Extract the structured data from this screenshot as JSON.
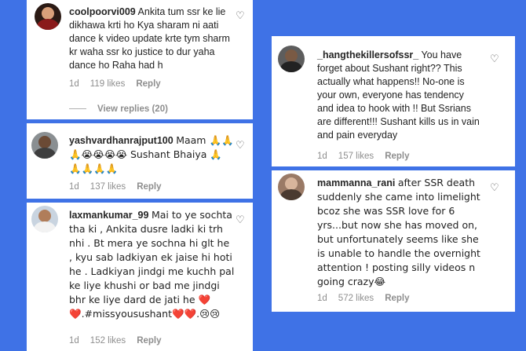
{
  "comments": [
    {
      "username": "coolpoorvi009",
      "text": "Ankita tum ssr ke lie dikhawa krti ho Kya sharam ni aati dance k video update krte tym sharm kr waha ssr ko justice to dur yaha dance ho Raha had h",
      "time": "1d",
      "likes": "119 likes",
      "reply": "Reply",
      "view_replies": "View replies (20)"
    },
    {
      "username": "yashvardhanrajput100",
      "text": "Maam 🙏🙏🙏😭😭😭😭 Sushant Bhaiya 🙏🙏🙏🙏🙏",
      "time": "1d",
      "likes": "137 likes",
      "reply": "Reply"
    },
    {
      "username": "laxmankumar_99",
      "text": "Mai to ye sochta tha ki , Ankita dusre ladki ki trh nhi . Bt mera ye sochna hi glt he , kyu sab ladkiyan ek jaise hi hoti he . Ladkiyan jindgi me kuchh pal ke liye khushi or bad me jindgi bhr ke liye dard de jati he ❤️❤️.#missyousushant❤️❤️.😢😢",
      "time": "1d",
      "likes": "152 likes",
      "reply": "Reply"
    },
    {
      "username": "_hangthekillersofssr_",
      "text": "You have forget about Sushant right?? This actually what happens!! No-one is your own, everyone has tendency and idea to hook with !! But Ssrians are different!!! Sushant kills us in vain and pain everyday",
      "time": "1d",
      "likes": "157 likes",
      "reply": "Reply"
    },
    {
      "username": "mammanna_rani",
      "text": "after SSR death suddenly she came into limelight bcoz she was SSR love for 6 yrs...but now she has moved on, but unfortunately seems like she is unable to handle the overnight attention ! posting silly videos n going crazy😂",
      "time": "1d",
      "likes": "572 likes",
      "reply": "Reply"
    }
  ],
  "icons": {
    "like": "heart-outline-icon"
  },
  "colors": {
    "background": "#3f72e6",
    "card": "#ffffff",
    "muted": "#8e8e8e"
  }
}
